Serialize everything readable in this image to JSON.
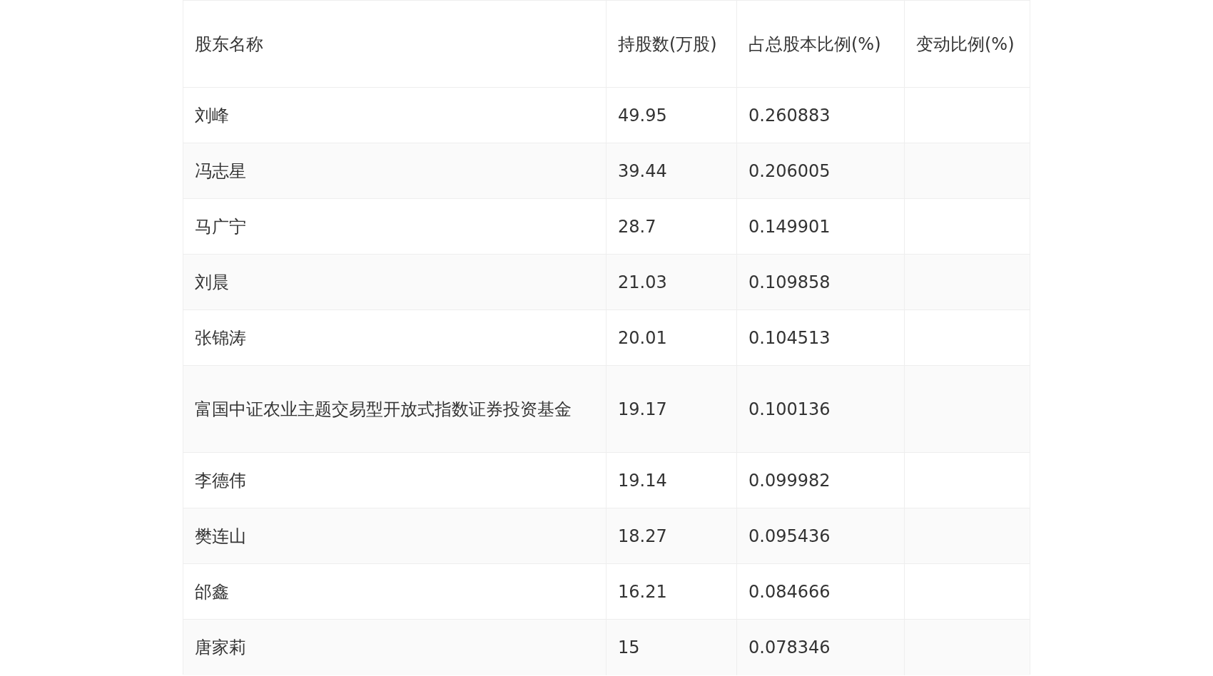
{
  "table": {
    "columns": [
      "股东名称",
      "持股数(万股)",
      "占总股本比例(%)",
      "变动比例(%)"
    ],
    "rows": [
      {
        "name": "刘峰",
        "shares": "49.95",
        "ratio": "0.260883"
      },
      {
        "name": "冯志星",
        "shares": "39.44",
        "ratio": "0.206005"
      },
      {
        "name": "马广宁",
        "shares": "28.7",
        "ratio": "0.149901"
      },
      {
        "name": "刘晨",
        "shares": "21.03",
        "ratio": "0.109858"
      },
      {
        "name": "张锦涛",
        "shares": "20.01",
        "ratio": "0.104513"
      },
      {
        "name": "富国中证农业主题交易型开放式指数证券投资基金",
        "shares": "19.17",
        "ratio": "0.100136"
      },
      {
        "name": "李德伟",
        "shares": "19.14",
        "ratio": "0.099982"
      },
      {
        "name": "樊连山",
        "shares": "18.27",
        "ratio": "0.095436"
      },
      {
        "name": "邰鑫",
        "shares": "16.21",
        "ratio": "0.084666"
      },
      {
        "name": "唐家莉",
        "shares": "15",
        "ratio": "0.078346"
      }
    ]
  }
}
